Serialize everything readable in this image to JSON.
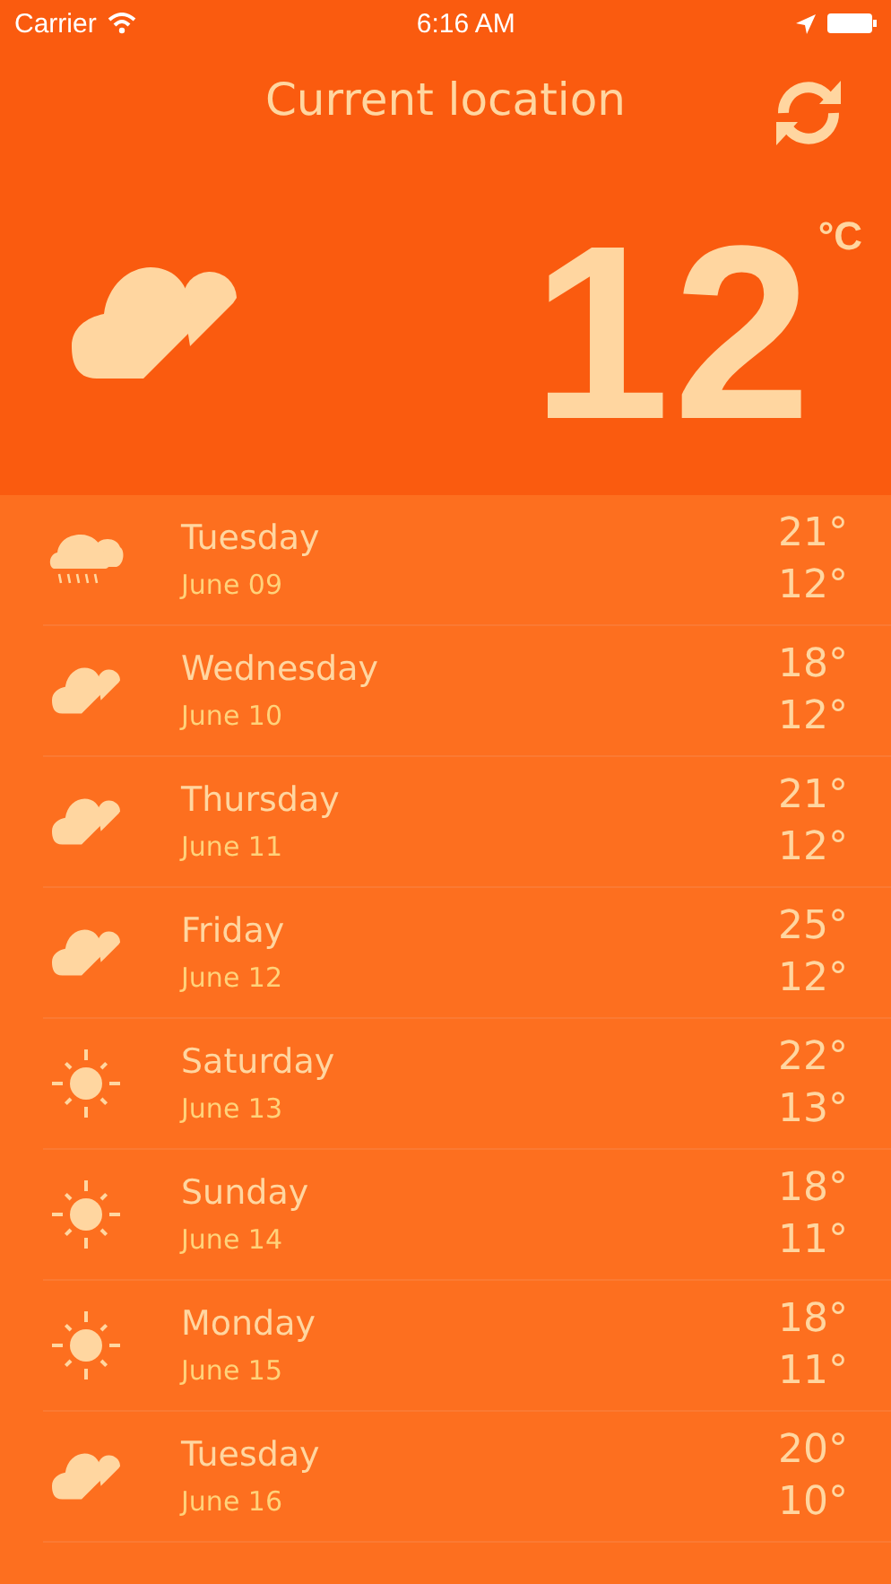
{
  "status_bar": {
    "carrier": "Carrier",
    "time": "6:16 AM"
  },
  "header": {
    "title": "Current location",
    "current": {
      "kind": "cloudy",
      "temperature": "12",
      "unit": "°C"
    }
  },
  "forecast": [
    {
      "kind": "rain",
      "day": "Tuesday",
      "date": "June 09",
      "high": "21°",
      "low": "12°"
    },
    {
      "kind": "cloudy",
      "day": "Wednesday",
      "date": "June 10",
      "high": "18°",
      "low": "12°"
    },
    {
      "kind": "cloudy",
      "day": "Thursday",
      "date": "June 11",
      "high": "21°",
      "low": "12°"
    },
    {
      "kind": "cloudy",
      "day": "Friday",
      "date": "June 12",
      "high": "25°",
      "low": "12°"
    },
    {
      "kind": "sunny",
      "day": "Saturday",
      "date": "June 13",
      "high": "22°",
      "low": "13°"
    },
    {
      "kind": "sunny",
      "day": "Sunday",
      "date": "June 14",
      "high": "18°",
      "low": "11°"
    },
    {
      "kind": "sunny",
      "day": "Monday",
      "date": "June 15",
      "high": "18°",
      "low": "11°"
    },
    {
      "kind": "cloudy",
      "day": "Tuesday",
      "date": "June 16",
      "high": "20°",
      "low": "10°"
    }
  ]
}
